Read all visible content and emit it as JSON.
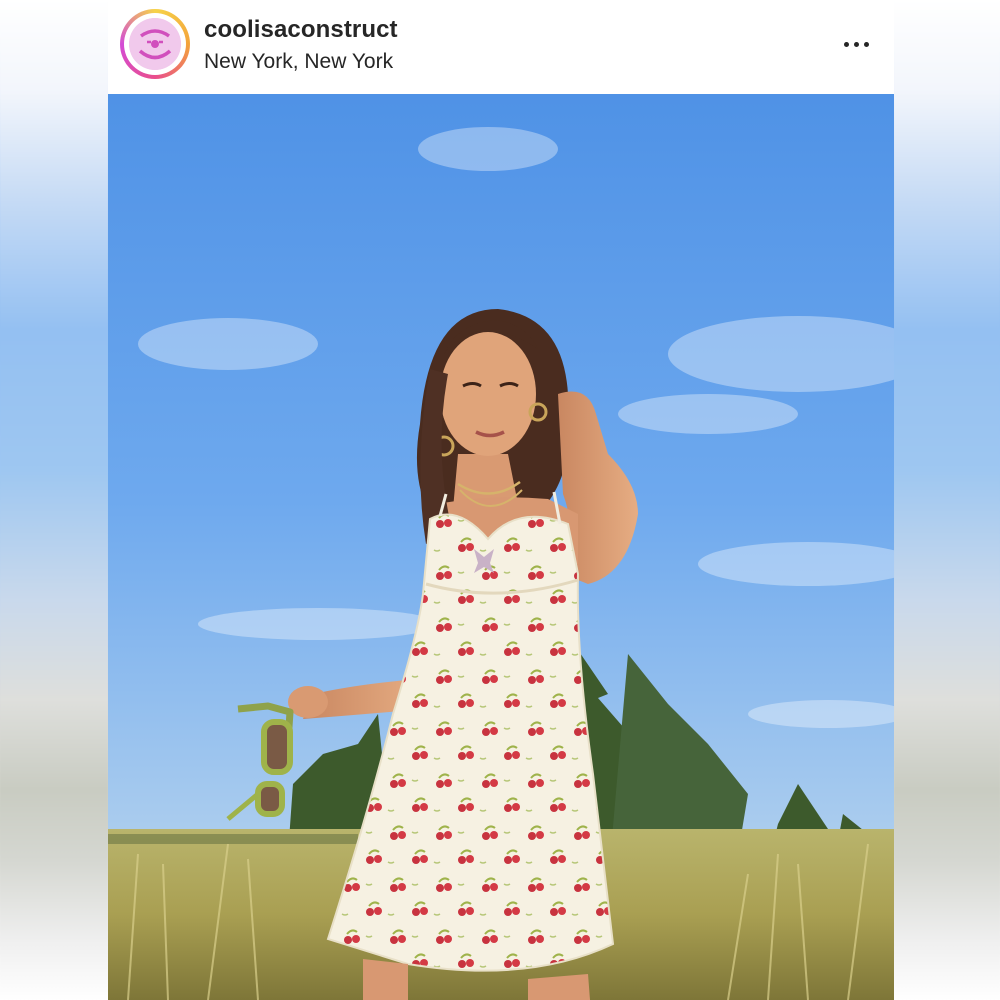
{
  "post": {
    "username": "coolisaconstruct",
    "location": "New York, New York",
    "avatar_icon": "cool-is-a-construct-logo",
    "more_icon": "more-horizontal-icon"
  },
  "photo": {
    "subject": "photo"
  },
  "colors": {
    "sky_top": "#5b9be8",
    "sky_bottom": "#a9cdf1",
    "grass": "#b8b26a",
    "tree": "#3f5a2e",
    "dress": "#f6f1e4",
    "cherry": "#c8333f"
  }
}
